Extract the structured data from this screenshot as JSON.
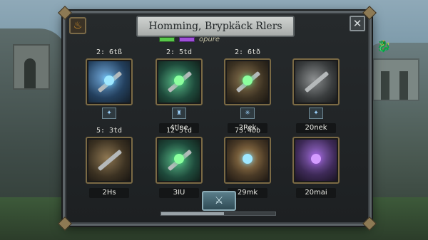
{
  "window": {
    "title": "Homming, Brypkäck Rlers",
    "resource_label": "opure",
    "close_icon": "close-icon",
    "flame_icon": "flame-icon"
  },
  "slots": [
    {
      "timer": "2: 6tß",
      "name": "",
      "badge": "✦",
      "icon": "blue-cannon-icon"
    },
    {
      "timer": "2: 5td",
      "name": "4tlne",
      "badge": "♜",
      "icon": "green-sword-icon"
    },
    {
      "timer": "2: 6tð",
      "name": "2Rek",
      "badge": "✳",
      "icon": "bronze-cannon-icon"
    },
    {
      "timer": "",
      "name": "20nek",
      "badge": "✦",
      "icon": "steel-cannon-icon"
    },
    {
      "timer": "5: 3td",
      "name": "2Hs",
      "badge": "",
      "icon": "bronze-sword-icon"
    },
    {
      "timer": "12-5td",
      "name": "ЗIU",
      "badge": "",
      "icon": "green-crossbow-icon"
    },
    {
      "timer": "73.4bb",
      "name": "29mk",
      "badge": "",
      "icon": "knight-helmet-icon"
    },
    {
      "timer": "",
      "name": "20mai",
      "badge": "",
      "icon": "purple-helmet-icon"
    }
  ],
  "footer": {
    "confirm_icon": "crossed-swords-icon",
    "progress": 0.55
  },
  "colors": {
    "accent_gold": "#8d7a54",
    "panel_bg": "#1d2022"
  }
}
